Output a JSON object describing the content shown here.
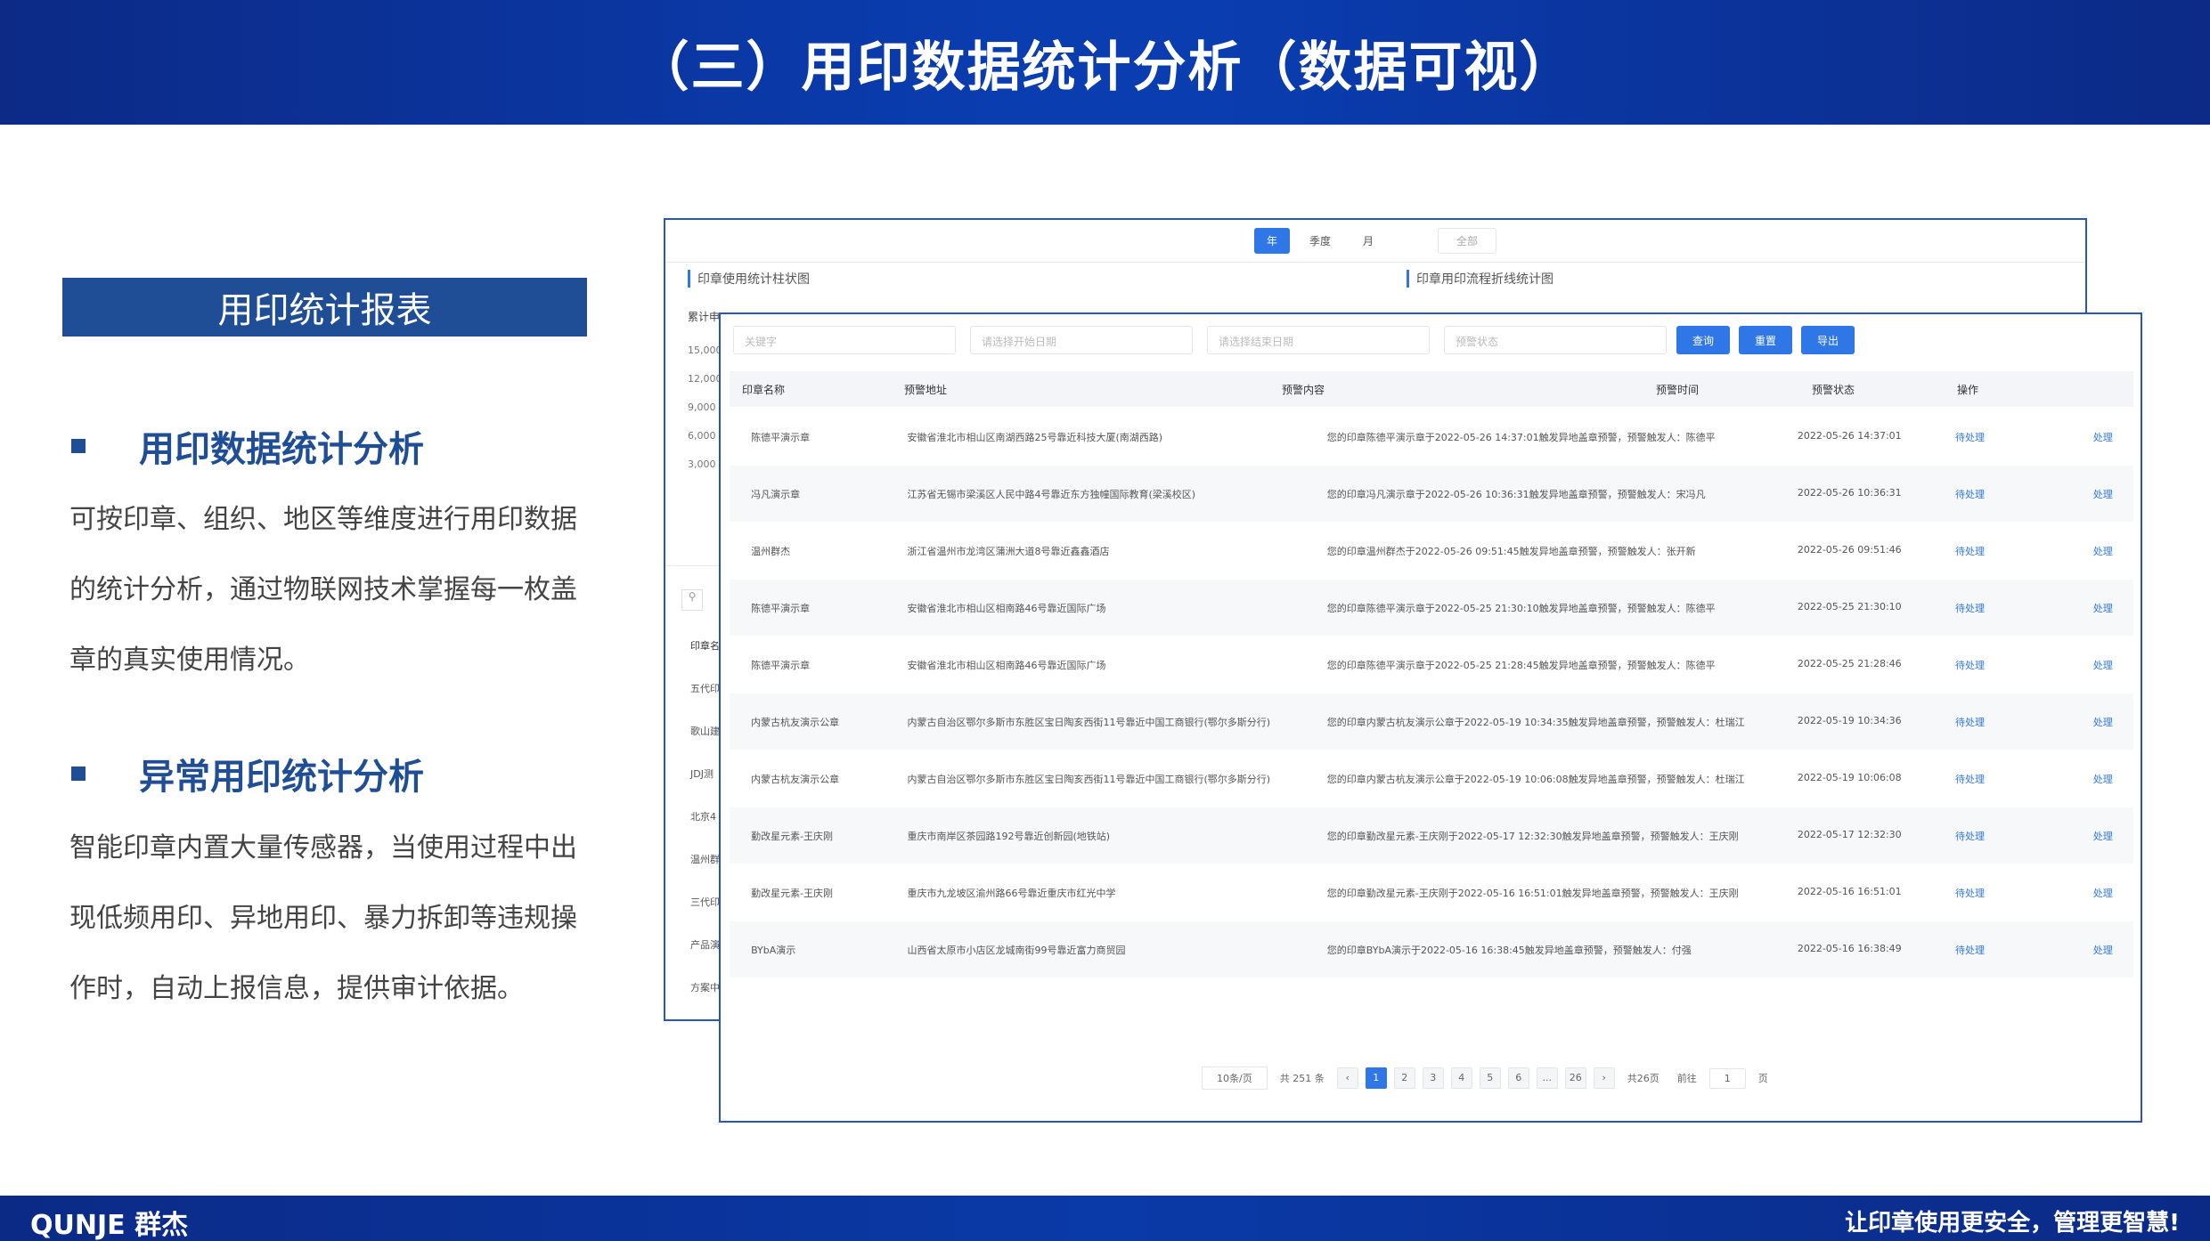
{
  "header": {
    "title": "（三）用印数据统计分析（数据可视）"
  },
  "left": {
    "box_title": "用印统计报表",
    "sections": [
      {
        "title": "用印数据统计分析",
        "body": "可按印章、组织、地区等维度进行用印数据的统计分析，通过物联网技术掌握每一枚盖章的真实使用情况。"
      },
      {
        "title": "异常用印统计分析",
        "body": "智能印章内置大量传感器，当使用过程中出现低频用印、异地用印、暴力拆卸等违规操作时，自动上报信息，提供审计依据。"
      }
    ]
  },
  "back_window": {
    "tabs": [
      "年",
      "季度",
      "月"
    ],
    "select": "全部",
    "panel_left_title": "印章使用统计柱状图",
    "panel_right_title": "印章用印流程折线统计图",
    "stat_label": "累计申",
    "y_ticks": [
      "15,000",
      "12,000",
      "9,000",
      "6,000",
      "3,000"
    ],
    "table_header": "印章名",
    "rows": [
      "五代印",
      "歌山建",
      "JDJ测",
      "北京4",
      "温州群",
      "三代印",
      "产品演",
      "方案中"
    ]
  },
  "front_window": {
    "filters": [
      "关键字",
      "请选择开始日期",
      "请选择结束日期",
      "预警状态"
    ],
    "buttons": [
      "查询",
      "重置",
      "导出"
    ],
    "columns": [
      "印章名称",
      "预警地址",
      "预警内容",
      "预警时间",
      "预警状态",
      "操作"
    ],
    "rows": [
      {
        "name": "陈德平演示章",
        "address": "安徽省淮北市相山区南湖西路25号靠近科技大厦(南湖西路)",
        "content": "您的印章陈德平演示章于2022-05-26 14:37:01触发异地盖章预警，预警触发人：陈德平",
        "time": "2022-05-26 14:37:01",
        "status": "待处理",
        "action": "处理"
      },
      {
        "name": "冯凡演示章",
        "address": "江苏省无锡市梁溪区人民中路4号靠近东方独幢国际教育(梁溪校区)",
        "content": "您的印章冯凡演示章于2022-05-26 10:36:31触发异地盖章预警，预警触发人：宋冯凡",
        "time": "2022-05-26 10:36:31",
        "status": "待处理",
        "action": "处理"
      },
      {
        "name": "温州群杰",
        "address": "浙江省温州市龙湾区蒲洲大道8号靠近鑫鑫酒店",
        "content": "您的印章温州群杰于2022-05-26 09:51:45触发异地盖章预警，预警触发人：张开新",
        "time": "2022-05-26 09:51:46",
        "status": "待处理",
        "action": "处理"
      },
      {
        "name": "陈德平演示章",
        "address": "安徽省淮北市相山区相南路46号靠近国际广场",
        "content": "您的印章陈德平演示章于2022-05-25 21:30:10触发异地盖章预警，预警触发人：陈德平",
        "time": "2022-05-25 21:30:10",
        "status": "待处理",
        "action": "处理"
      },
      {
        "name": "陈德平演示章",
        "address": "安徽省淮北市相山区相南路46号靠近国际广场",
        "content": "您的印章陈德平演示章于2022-05-25 21:28:45触发异地盖章预警，预警触发人：陈德平",
        "time": "2022-05-25 21:28:46",
        "status": "待处理",
        "action": "处理"
      },
      {
        "name": "内蒙古杭友演示公章",
        "address": "内蒙古自治区鄂尔多斯市东胜区宝日陶亥西街11号靠近中国工商银行(鄂尔多斯分行)",
        "content": "您的印章内蒙古杭友演示公章于2022-05-19 10:34:35触发异地盖章预警，预警触发人：杜瑞江",
        "time": "2022-05-19 10:34:36",
        "status": "待处理",
        "action": "处理"
      },
      {
        "name": "内蒙古杭友演示公章",
        "address": "内蒙古自治区鄂尔多斯市东胜区宝日陶亥西街11号靠近中国工商银行(鄂尔多斯分行)",
        "content": "您的印章内蒙古杭友演示公章于2022-05-19 10:06:08触发异地盖章预警，预警触发人：杜瑞江",
        "time": "2022-05-19 10:06:08",
        "status": "待处理",
        "action": "处理"
      },
      {
        "name": "勤改星元素-王庆刚",
        "address": "重庆市南岸区茶园路192号靠近创新园(地铁站)",
        "content": "您的印章勤改星元素-王庆刚于2022-05-17 12:32:30触发异地盖章预警，预警触发人：王庆刚",
        "time": "2022-05-17 12:32:30",
        "status": "待处理",
        "action": "处理"
      },
      {
        "name": "勤改星元素-王庆刚",
        "address": "重庆市九龙坡区渝州路66号靠近重庆市红光中学",
        "content": "您的印章勤改星元素-王庆刚于2022-05-16 16:51:01触发异地盖章预警，预警触发人：王庆刚",
        "time": "2022-05-16 16:51:01",
        "status": "待处理",
        "action": "处理"
      },
      {
        "name": "BYbA演示",
        "address": "山西省太原市小店区龙城南街99号靠近富力商贸园",
        "content": "您的印章BYbA演示于2022-05-16 16:38:45触发异地盖章预警，预警触发人：付强",
        "time": "2022-05-16 16:38:49",
        "status": "待处理",
        "action": "处理"
      }
    ],
    "pager": {
      "size": "10条/页",
      "total": "共 251 条",
      "prev": "‹",
      "pages": [
        "1",
        "2",
        "3",
        "4",
        "5",
        "6",
        "...",
        "26"
      ],
      "next": "›",
      "total_pages": "共26页",
      "goto_label": "前往",
      "goto_value": "1",
      "goto_suffix": "页"
    }
  },
  "footer": {
    "brand": "QUNJE 群杰",
    "slogan": "让印章使用更安全，管理更智慧!"
  }
}
